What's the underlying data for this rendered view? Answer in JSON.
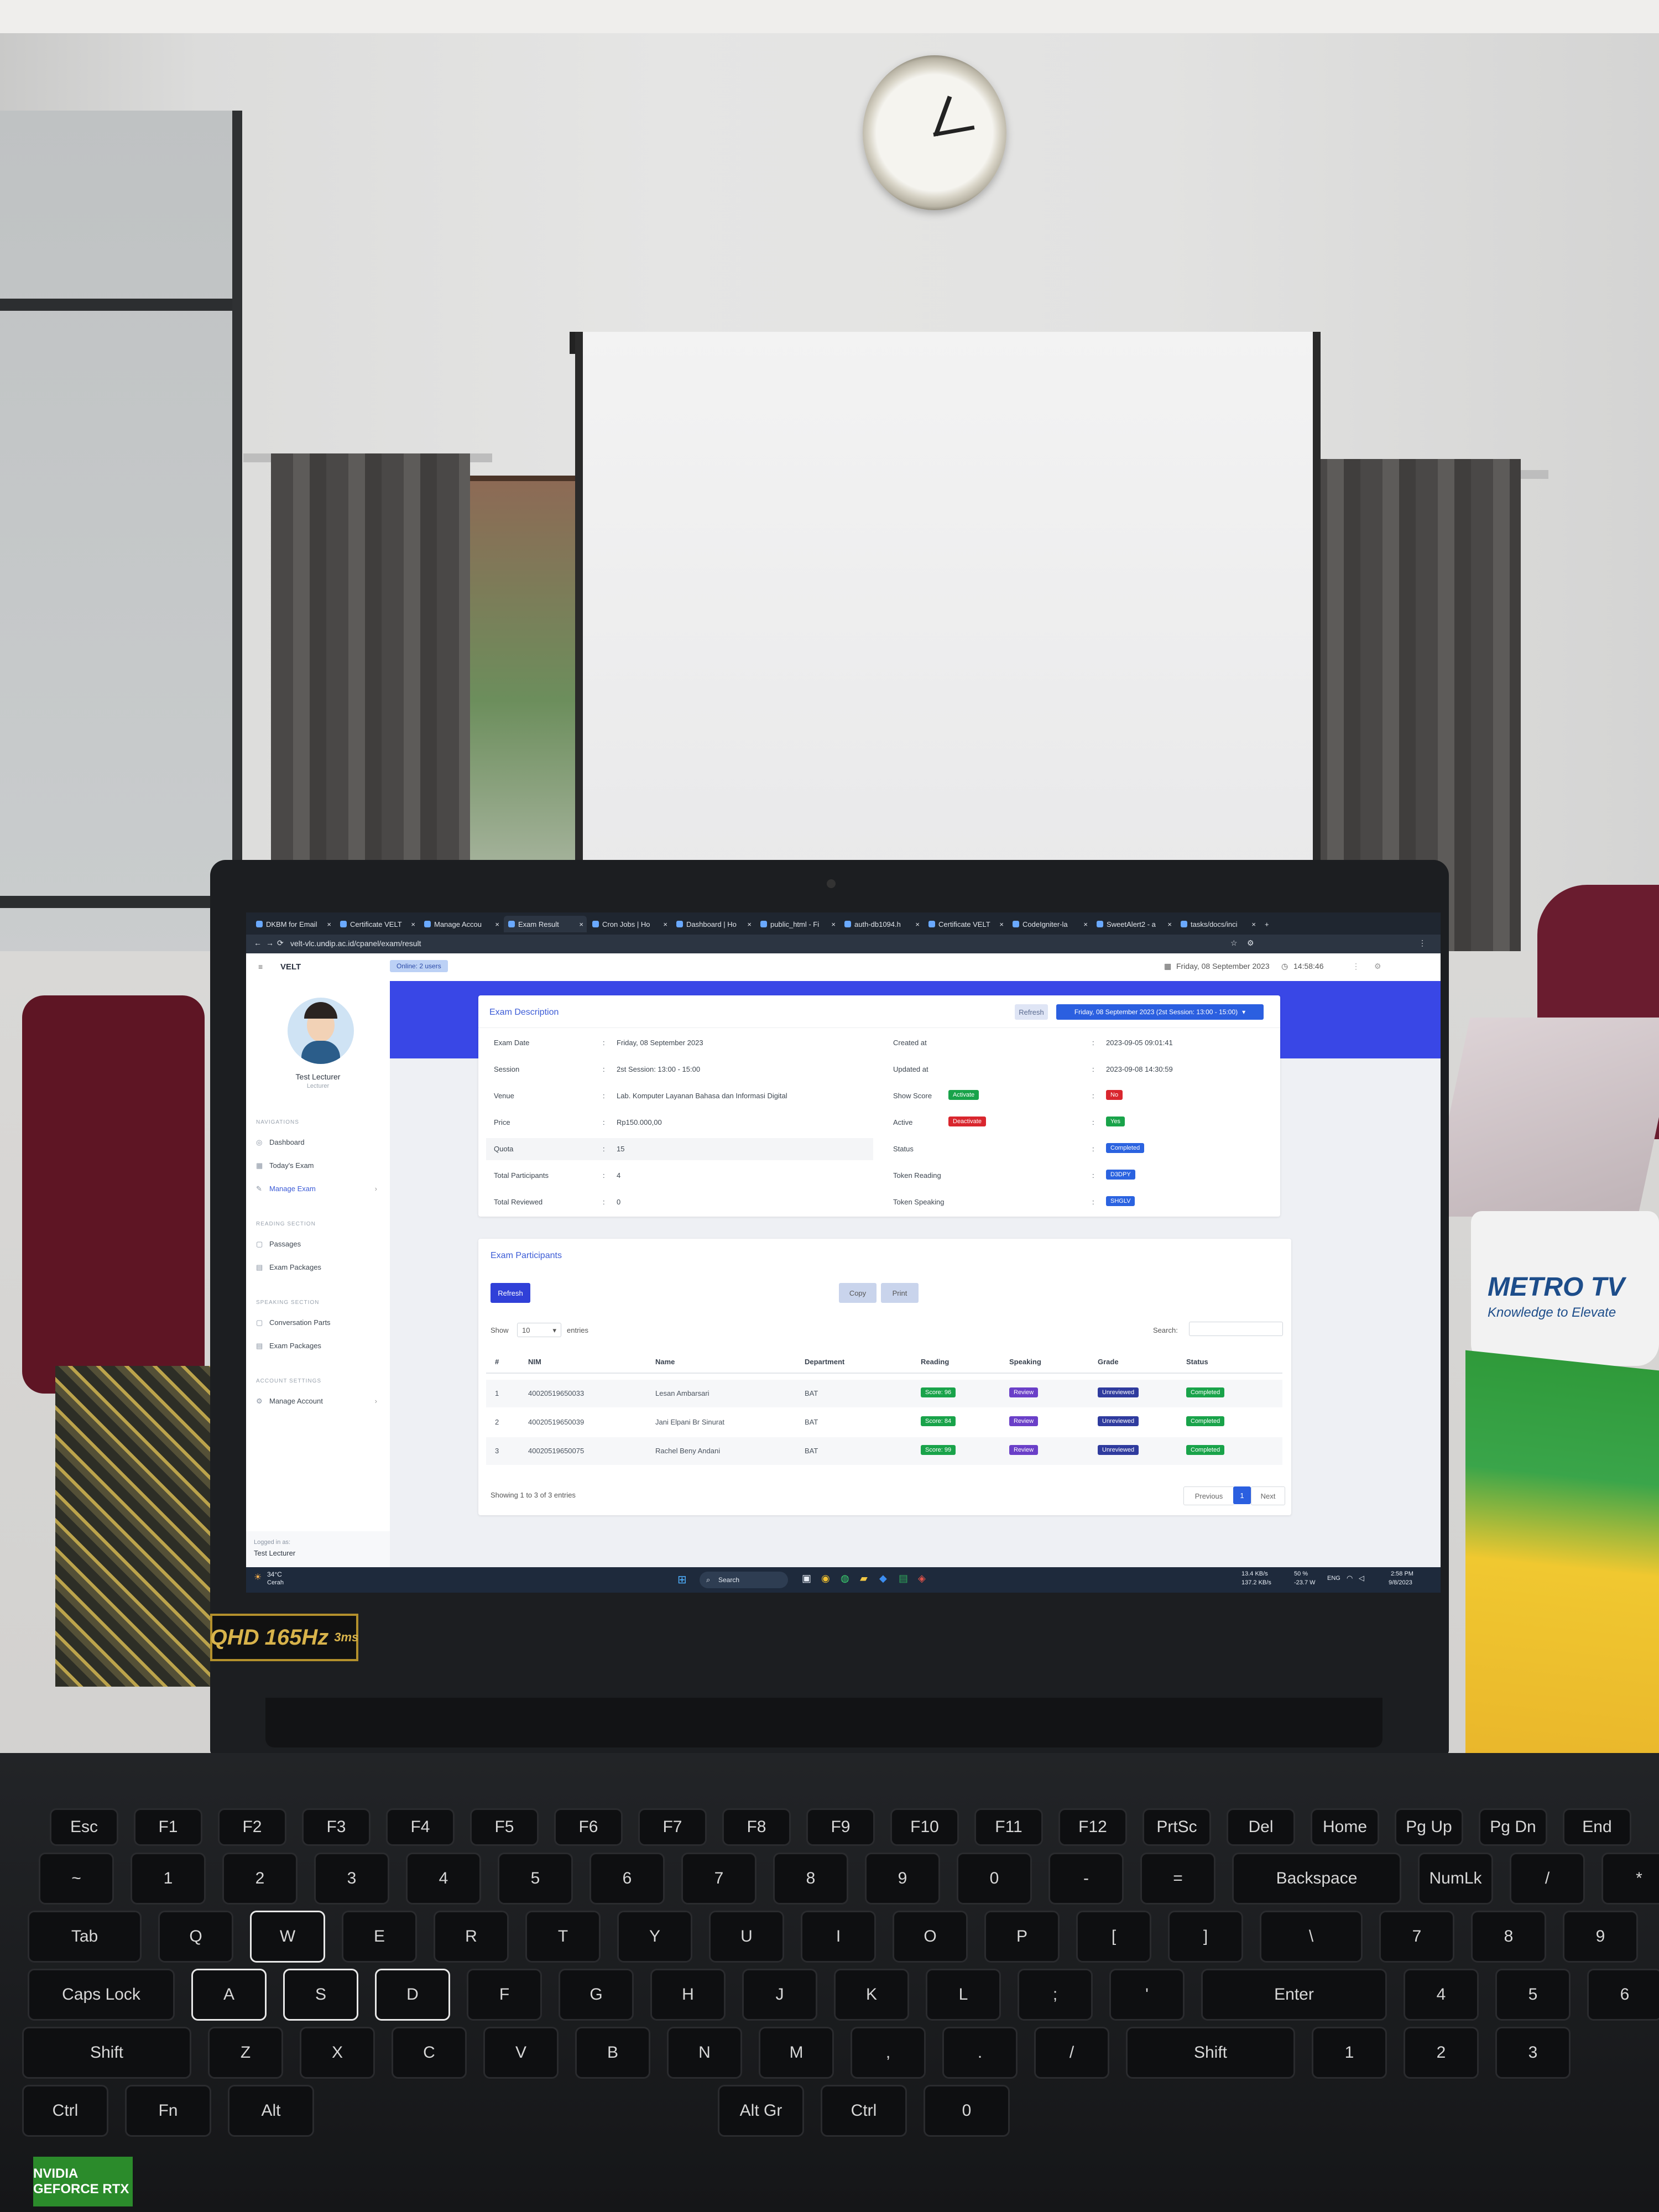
{
  "browser": {
    "tabs": [
      {
        "label": "DKBM for Email"
      },
      {
        "label": "Certificate VELT"
      },
      {
        "label": "Manage Accou"
      },
      {
        "label": "Exam Result"
      },
      {
        "label": "Cron Jobs | Ho"
      },
      {
        "label": "Dashboard | Ho"
      },
      {
        "label": "public_html - Fi"
      },
      {
        "label": "auth-db1094.h"
      },
      {
        "label": "Certificate VELT"
      },
      {
        "label": "CodeIgniter-la"
      },
      {
        "label": "SweetAlert2 - a"
      },
      {
        "label": "tasks/docs/inci"
      }
    ],
    "url": "velt-vlc.undip.ac.id/cpanel/exam/result"
  },
  "app": {
    "brand": "VELT",
    "online_badge": "Online: 2 users",
    "date": "Friday, 08 September 2023",
    "time": "14:58:46"
  },
  "sidebar": {
    "user_name": "Test Lecturer",
    "user_role": "Lecturer",
    "sections": [
      {
        "title": "NAVIGATIONS",
        "items": [
          "Dashboard",
          "Today's Exam",
          "Manage Exam"
        ]
      },
      {
        "title": "READING SECTION",
        "items": [
          "Passages",
          "Exam Packages"
        ]
      },
      {
        "title": "SPEAKING SECTION",
        "items": [
          "Conversation Parts",
          "Exam Packages"
        ]
      },
      {
        "title": "ACCOUNT SETTINGS",
        "items": [
          "Manage Account"
        ]
      }
    ],
    "logged_in_label": "Logged in as:",
    "logged_in_user": "Test Lecturer"
  },
  "exam_description": {
    "title": "Exam Description",
    "refresh_label": "Refresh",
    "session_select": "Friday, 08 September 2023 (2st Session: 13:00 - 15:00)",
    "left": [
      {
        "label": "Exam Date",
        "value": "Friday, 08 September 2023"
      },
      {
        "label": "Session",
        "value": "2st Session: 13:00 - 15:00"
      },
      {
        "label": "Venue",
        "value": "Lab. Komputer Layanan Bahasa dan Informasi Digital"
      },
      {
        "label": "Price",
        "value": "Rp150.000,00"
      },
      {
        "label": "Quota",
        "value": "15"
      },
      {
        "label": "Total Participants",
        "value": "4"
      },
      {
        "label": "Total Reviewed",
        "value": "0"
      }
    ],
    "right": [
      {
        "label": "Created at",
        "value": "2023-09-05 09:01:41"
      },
      {
        "label": "Updated at",
        "value": "2023-09-08 14:30:59"
      },
      {
        "label": "Show Score",
        "action": "Activate",
        "value": "No"
      },
      {
        "label": "Active",
        "action": "Deactivate",
        "value": "Yes"
      },
      {
        "label": "Status",
        "value": "Completed"
      },
      {
        "label": "Token Reading",
        "value": "D3DPY"
      },
      {
        "label": "Token Speaking",
        "value": "SHGLV"
      }
    ]
  },
  "participants": {
    "title": "Exam Participants",
    "refresh_label": "Refresh",
    "copy_label": "Copy",
    "print_label": "Print",
    "show_label": "Show",
    "entries_value": "10",
    "entries_label": "entries",
    "search_label": "Search:",
    "columns": [
      "#",
      "NIM",
      "Name",
      "Department",
      "Reading",
      "Speaking",
      "Grade",
      "Status"
    ],
    "rows": [
      {
        "no": "1",
        "nim": "40020519650033",
        "name": "Lesan Ambarsari",
        "dept": "BAT",
        "reading": "Score: 96",
        "speaking": "Review",
        "grade": "Unreviewed",
        "status": "Completed"
      },
      {
        "no": "2",
        "nim": "40020519650039",
        "name": "Jani Elpani Br Sinurat",
        "dept": "BAT",
        "reading": "Score: 84",
        "speaking": "Review",
        "grade": "Unreviewed",
        "status": "Completed"
      },
      {
        "no": "3",
        "nim": "40020519650075",
        "name": "Rachel Beny Andani",
        "dept": "BAT",
        "reading": "Score: 99",
        "speaking": "Review",
        "grade": "Unreviewed",
        "status": "Completed"
      }
    ],
    "footer": "Showing 1 to 3 of 3 entries",
    "prev_label": "Previous",
    "page": "1",
    "next_label": "Next"
  },
  "taskbar": {
    "weather_temp": "34°C",
    "weather_desc": "Cerah",
    "search_label": "Search",
    "net_up": "13.4 KB/s",
    "net_down": "137.2 KB/s",
    "battery": "50 %",
    "power": "-23.7 W",
    "lang": "ENG",
    "time": "2:58 PM",
    "date": "9/8/2023"
  },
  "hardware": {
    "qhd_label": "QHD",
    "refresh_rate": "165Hz",
    "response": "3ms",
    "mug_logo": "METRO TV",
    "mug_tagline": "Knowledge to Elevate",
    "gpu_sticker": "NVIDIA GEFORCE RTX",
    "keys_row1": [
      "Esc",
      "F1",
      "F2",
      "F3",
      "F4",
      "F5",
      "F6",
      "F7",
      "F8",
      "F9",
      "F10",
      "F11",
      "F12",
      "PrtSc",
      "Del",
      "Home",
      "Pg Up",
      "Pg Dn",
      "End"
    ],
    "keys_row2": [
      "~",
      "1",
      "2",
      "3",
      "4",
      "5",
      "6",
      "7",
      "8",
      "9",
      "0",
      "-",
      "=",
      "Backspace",
      "NumLk",
      "/",
      "*"
    ],
    "keys_row3": [
      "Tab",
      "Q",
      "W",
      "E",
      "R",
      "T",
      "Y",
      "U",
      "I",
      "O",
      "P",
      "[",
      "]",
      "\\",
      "7",
      "8",
      "9"
    ],
    "keys_row4": [
      "Caps Lock",
      "A",
      "S",
      "D",
      "F",
      "G",
      "H",
      "J",
      "K",
      "L",
      ";",
      "'",
      "Enter",
      "4",
      "5",
      "6"
    ],
    "keys_row5": [
      "Shift",
      "Z",
      "X",
      "C",
      "V",
      "B",
      "N",
      "M",
      ",",
      ".",
      "/",
      "Shift",
      "1",
      "2",
      "3"
    ],
    "keys_row6": [
      "Ctrl",
      "Fn",
      "Alt",
      "Alt Gr",
      "Ctrl",
      "0"
    ]
  },
  "colors": {
    "banner": "#3947e6",
    "accent": "#3b5bd6",
    "success": "#19a34a",
    "danger": "#d9262e"
  }
}
